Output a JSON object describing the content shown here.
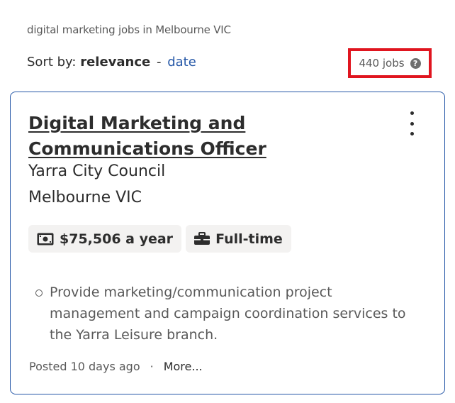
{
  "search": {
    "description": "digital marketing jobs in Melbourne VIC",
    "sort_prefix": "Sort by:",
    "sort_current": "relevance",
    "sort_separator": "-",
    "sort_alternative": "date",
    "job_count": "440 jobs",
    "help_icon": "question-mark-circle-icon"
  },
  "job": {
    "title": "Digital Marketing and Communications Officer",
    "company": "Yarra City Council",
    "location": "Melbourne VIC",
    "salary": "$75,506 a year",
    "salary_icon": "money-icon",
    "job_type": "Full-time",
    "job_type_icon": "briefcase-icon",
    "snippet": "Provide marketing/communication project management and campaign coordination services to the Yarra Leisure branch.",
    "posted": "Posted 10 days ago",
    "separator": "·",
    "more": "More..."
  },
  "colors": {
    "link": "#2557a7",
    "highlight_box": "#e0151f",
    "tag_background": "#f3f2f1"
  }
}
